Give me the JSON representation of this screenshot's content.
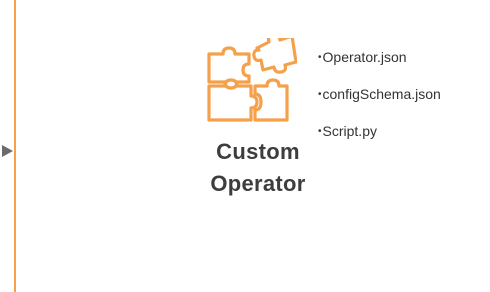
{
  "diagram": {
    "accent_color": "#F5A04A",
    "connector_color": "#6b6b6b",
    "node": {
      "icon": "puzzle-icon",
      "title_line1": "Custom",
      "title_line2": "Operator"
    },
    "files": [
      {
        "name": "Operator.json"
      },
      {
        "name": "configSchema.json"
      },
      {
        "name": "Script.py"
      }
    ]
  }
}
